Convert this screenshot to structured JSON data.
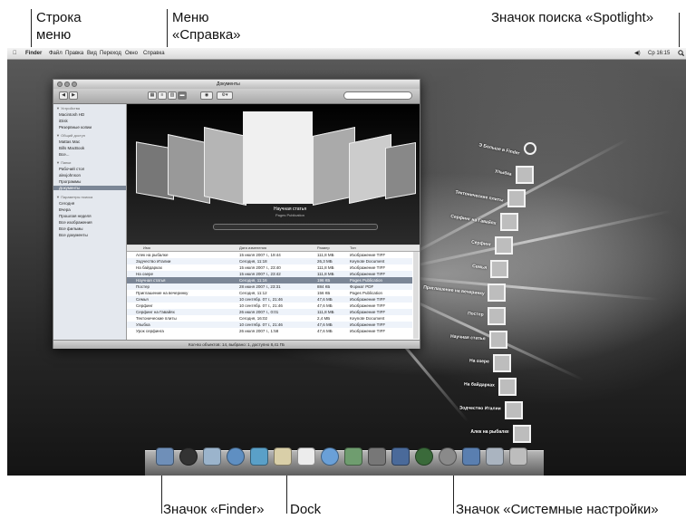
{
  "callouts": {
    "menubar": "Строка\nменю",
    "help_menu": "Меню\n«Справка»",
    "spotlight": "Значок поиска «Spotlight»",
    "finder_icon": "Значок «Finder»",
    "dock": "Dock",
    "sysprefs_icon": "Значок «Системные настройки»"
  },
  "menubar": {
    "apple": "",
    "items": [
      "Finder",
      "Файл",
      "Правка",
      "Вид",
      "Переход",
      "Окно",
      "Справка"
    ],
    "volume": "◀)",
    "clock": "Ср 16:15",
    "spotlight_icon": "search-icon"
  },
  "window": {
    "title": "Документы",
    "sidebar": {
      "devices_header": "▼ Устройства",
      "devices": [
        "Macintosh HD",
        "iDisk",
        "Резервные копии"
      ],
      "shared_header": "▼ Общий доступ",
      "shared": [
        "Mattas Mac",
        "Bills MacBook",
        "Все..."
      ],
      "places_header": "▼ Папки",
      "places": [
        "Рабочий стол",
        "alexjohnson",
        "Программы",
        "Документы"
      ],
      "search_header": "▼ Параметры поиска",
      "search": [
        "Сегодня",
        "Вчера",
        "Прошлая неделя",
        "Все изображения",
        "Все фильмы",
        "Все документы"
      ]
    },
    "coverflow": {
      "caption": "Научная статья",
      "subcaption": "Pages Publication"
    },
    "columns": [
      "Имя",
      "Дата изменения",
      "Размер",
      "Тип"
    ],
    "rows": [
      {
        "name": "Алек на рыбалке",
        "date": "15 июля 2007 г., 19:44",
        "size": "111,8 МБ",
        "kind": "Изображение TIFF"
      },
      {
        "name": "Зодчество Италии",
        "date": "Сегодня, 11:18",
        "size": "26,3 МБ",
        "kind": "Keynote Document"
      },
      {
        "name": "На байдарках",
        "date": "15 июля 2007 г., 23:40",
        "size": "111,8 МБ",
        "kind": "Изображение TIFF"
      },
      {
        "name": "На озере",
        "date": "15 июля 2007 г., 23:42",
        "size": "111,8 МБ",
        "kind": "Изображение TIFF"
      },
      {
        "name": "Научная статья",
        "date": "Сегодня, 11:16",
        "size": "196 КБ",
        "kind": "Pages Publication"
      },
      {
        "name": "Постер",
        "date": "28 июня 2007 г., 23:31",
        "size": "884 КБ",
        "kind": "Формат PDF"
      },
      {
        "name": "Приглашение на вечеринку",
        "date": "Сегодня, 11:12",
        "size": "156 КБ",
        "kind": "Pages Publication"
      },
      {
        "name": "Семья",
        "date": "10 сентябр. 07 г., 21:46",
        "size": "47,6 МБ",
        "kind": "Изображение TIFF"
      },
      {
        "name": "Серфинг",
        "date": "10 сентябр. 07 г., 21:46",
        "size": "47,6 МБ",
        "kind": "Изображение TIFF"
      },
      {
        "name": "Серфинг на Гавайях",
        "date": "26 июля 2007 г., 0:01",
        "size": "111,8 МБ",
        "kind": "Изображение TIFF"
      },
      {
        "name": "Тектонические плиты",
        "date": "Сегодня, 16:02",
        "size": "2,4 МБ",
        "kind": "Keynote Document"
      },
      {
        "name": "Улыбка",
        "date": "10 сентябр. 07 г., 21:46",
        "size": "47,6 МБ",
        "kind": "Изображение TIFF"
      },
      {
        "name": "Урок серфинга",
        "date": "26 июля 2007 г., 1:58",
        "size": "47,6 МБ",
        "kind": "Изображение TIFF"
      }
    ],
    "selected_row": 4,
    "status": "Кол-во объектов: 14, выбрано: 1, доступно 8,41 ГБ"
  },
  "stack": {
    "items": [
      "Э Больше в Finder",
      "Улыбка",
      "Тектонические плиты",
      "Серфинг на Гавайях",
      "Серфинг",
      "Семья",
      "Приглашение на вечеринку",
      "Постер",
      "Научная статья",
      "На озере",
      "На байдарках",
      "Зодчество Италии",
      "Алек на рыбалке"
    ]
  },
  "dock": {
    "icons": [
      "finder-icon",
      "dashboard-icon",
      "mail-icon",
      "safari-icon",
      "ichat-icon",
      "address-book-icon",
      "ical-icon",
      "itunes-icon",
      "iphoto-icon",
      "imovie-icon",
      "spaces-icon",
      "time-machine-icon",
      "system-preferences-icon",
      "downloads-stack-icon",
      "documents-stack-icon",
      "trash-icon"
    ]
  },
  "colors": {
    "accent_selection": "#7b8696",
    "sidebar_bg": "#e4e8ee"
  }
}
